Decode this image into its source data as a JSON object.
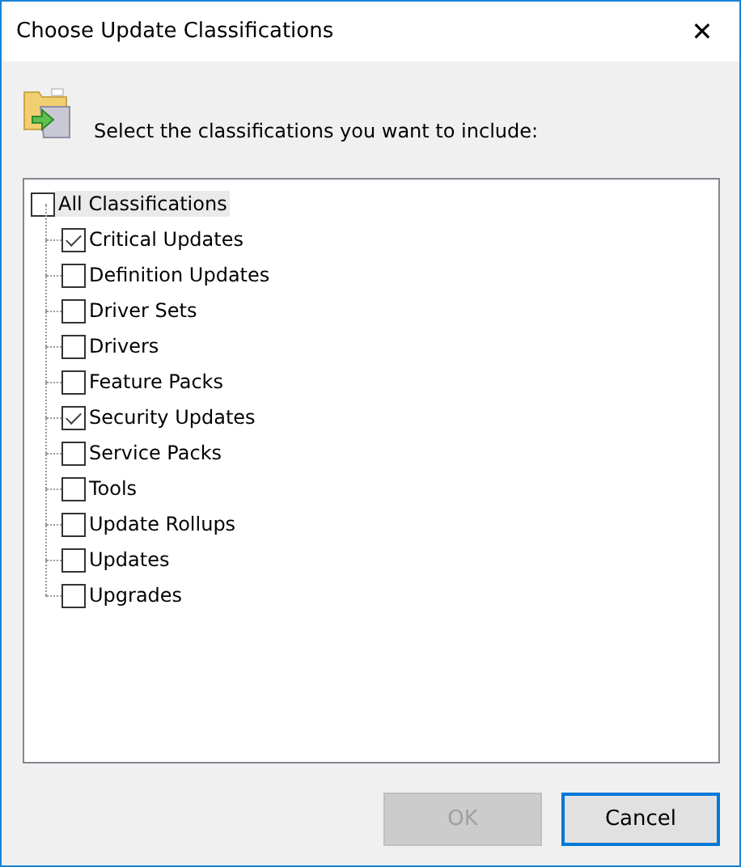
{
  "window": {
    "title": "Choose Update Classifications",
    "close": "✕"
  },
  "prompt": "Select the classifications you want to include:",
  "tree": {
    "label": "All Classifications",
    "checked": false,
    "selected": true,
    "children": [
      {
        "label": "Critical Updates",
        "checked": true
      },
      {
        "label": "Definition Updates",
        "checked": false
      },
      {
        "label": "Driver Sets",
        "checked": false
      },
      {
        "label": "Drivers",
        "checked": false
      },
      {
        "label": "Feature Packs",
        "checked": false
      },
      {
        "label": "Security Updates",
        "checked": true
      },
      {
        "label": "Service Packs",
        "checked": false
      },
      {
        "label": "Tools",
        "checked": false
      },
      {
        "label": "Update Rollups",
        "checked": false
      },
      {
        "label": "Updates",
        "checked": false
      },
      {
        "label": "Upgrades",
        "checked": false
      }
    ]
  },
  "buttons": [
    {
      "label": "OK",
      "disabled": true,
      "default": false
    },
    {
      "label": "Cancel",
      "disabled": false,
      "default": true
    }
  ]
}
